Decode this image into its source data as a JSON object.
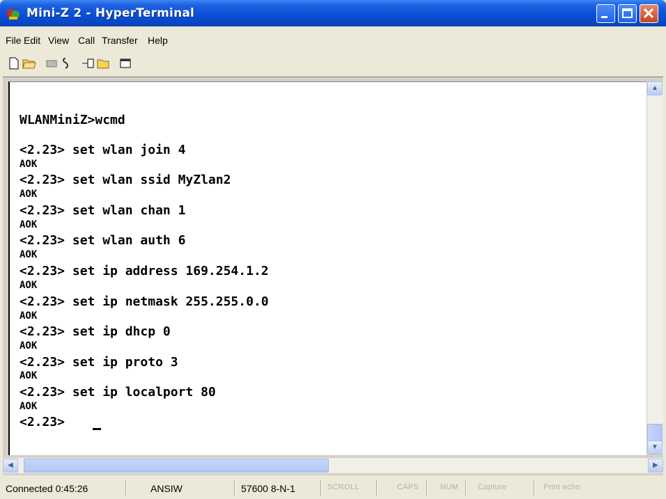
{
  "window": {
    "title": "Mini-Z  2 - HyperTerminal"
  },
  "menu": {
    "items": [
      "File",
      "Edit",
      "View",
      "Call",
      "Transfer",
      "Help"
    ]
  },
  "toolbar": {
    "icons": [
      "new-icon",
      "open-icon",
      "connect-icon",
      "disconnect-icon",
      "send-icon",
      "receive-icon",
      "properties-icon"
    ]
  },
  "terminal": {
    "lines": [
      "WLANMiniZ>wcmd",
      "<2.23> set wlan join 4",
      "AOK",
      "<2.23> set wlan ssid MyZlan2",
      "AOK",
      "<2.23> set wlan chan 1",
      "AOK",
      "<2.23> set wlan auth 6",
      "AOK",
      "<2.23> set ip address 169.254.1.2",
      "AOK",
      "<2.23> set ip netmask 255.255.0.0",
      "AOK",
      "<2.23> set ip dhcp 0",
      "AOK",
      "<2.23> set ip proto 3",
      "AOK",
      "<2.23> set ip localport 80",
      "AOK",
      "<2.23> "
    ]
  },
  "status": {
    "connected": "Connected 0:45:26",
    "emulation": "ANSIW",
    "settings": "57600 8-N-1",
    "scroll": "SCROLL",
    "caps": "CAPS",
    "num": "NUM",
    "capture": "Capture",
    "printecho": "Print echo"
  },
  "colors": {
    "titlebar": "#0a50d8",
    "close_button": "#c5451f",
    "terminal_bg": "#ffffff"
  }
}
